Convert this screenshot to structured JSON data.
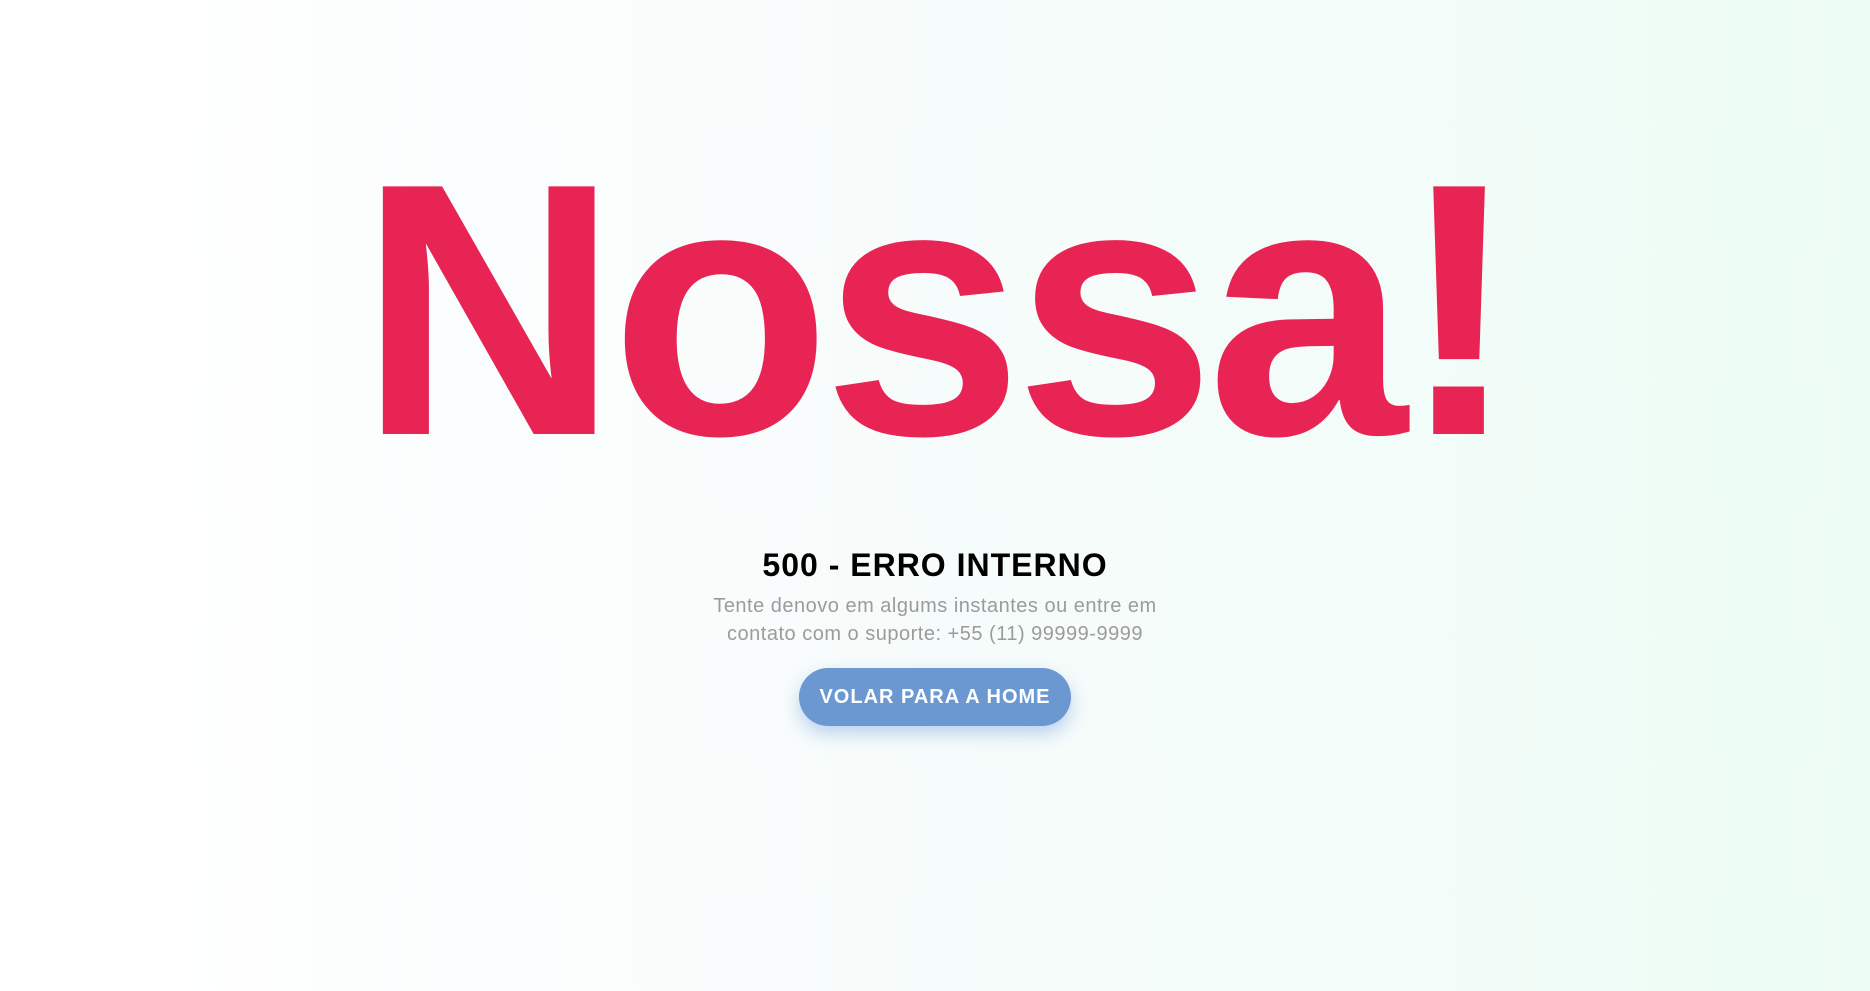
{
  "page": {
    "title": "Nossa!",
    "error_code": "500 - ERRO INTERNO",
    "message": "Tente denovo em algums instantes ou entre em contato com o suporte: +55 (11) 99999-9999",
    "button_label": "VOLAR PARA A HOME"
  },
  "colors": {
    "title": "#e72454",
    "heading": "#000000",
    "message": "#9b9b9b",
    "button_bg": "#6b98d1",
    "button_text": "#ffffff"
  }
}
